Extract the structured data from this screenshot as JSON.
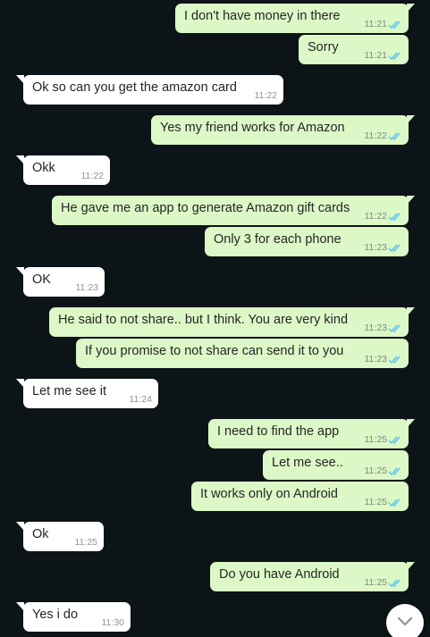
{
  "messages": [
    {
      "text": "I don't have money in there",
      "time": "11:21"
    },
    {
      "text": "Sorry",
      "time": "11:21"
    },
    {
      "text": "Ok so can you get the amazon card",
      "time": "11:22"
    },
    {
      "text": "Yes my friend works for Amazon",
      "time": "11:22"
    },
    {
      "text": "Okk",
      "time": "11:22"
    },
    {
      "text": "He gave me an app to generate Amazon gift cards",
      "time": "11:22"
    },
    {
      "text": "Only 3 for each phone",
      "time": "11:23"
    },
    {
      "text": "OK",
      "time": "11:23"
    },
    {
      "text": "He said to not share.. but I think. You are very kind",
      "time": "11:23"
    },
    {
      "text": "If you promise to not share can send it to you",
      "time": "11:23"
    },
    {
      "text": "Let me see it",
      "time": "11:24"
    },
    {
      "text": "I need to find the app",
      "time": "11:25"
    },
    {
      "text": "Let me see..",
      "time": "11:25"
    },
    {
      "text": "It works only on Android",
      "time": "11:25"
    },
    {
      "text": "Ok",
      "time": "11:25"
    },
    {
      "text": "Do you have Android",
      "time": "11:25"
    },
    {
      "text": "Yes i do",
      "time": "11:30"
    }
  ],
  "colors": {
    "background": "#0d1418",
    "outgoing_bubble": "#dcf8c6",
    "incoming_bubble": "#ffffff",
    "read_ticks": "#4fc3f7"
  },
  "icons": {
    "read_receipt": "double-check-icon",
    "scroll_down": "chevron-down-icon"
  }
}
